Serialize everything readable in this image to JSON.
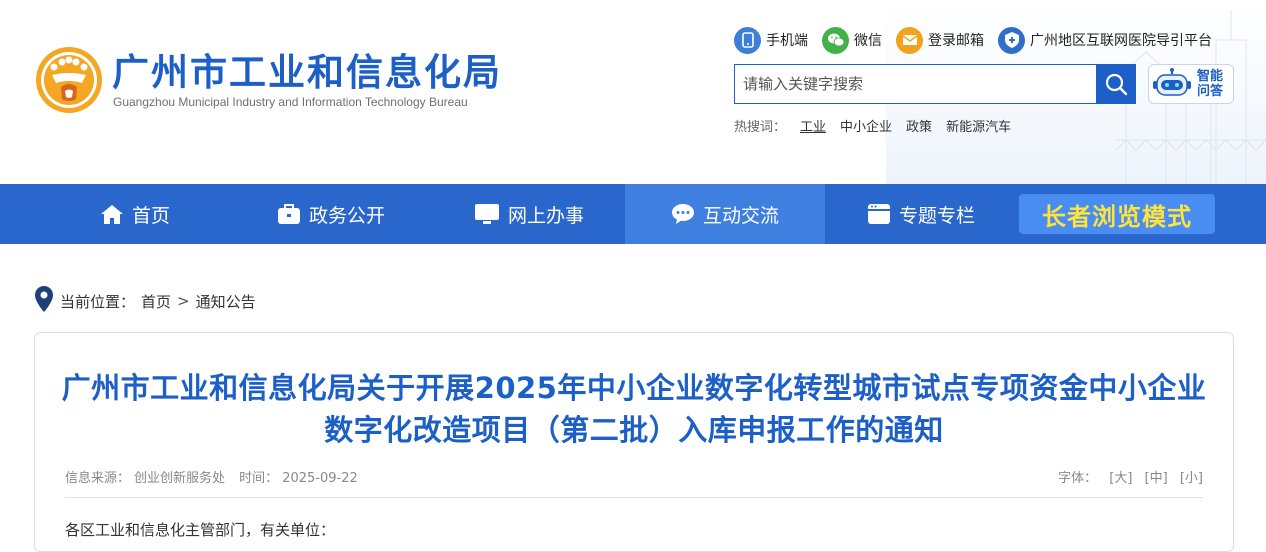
{
  "site": {
    "title": "广州市工业和信息化局",
    "subtitle": "Guangzhou Municipal Industry and Information Technology Bureau"
  },
  "top_links": [
    {
      "label": "手机端",
      "icon": "mobile-icon",
      "color": "#3d7fd6"
    },
    {
      "label": "微信",
      "icon": "wechat-icon",
      "color": "#43b14b"
    },
    {
      "label": "登录邮箱",
      "icon": "mail-icon",
      "color": "#f2a21f"
    },
    {
      "label": "广州地区互联网医院导引平台",
      "icon": "hospital-shield-icon",
      "color": "#2f6fc9"
    }
  ],
  "search": {
    "placeholder": "请输入关键字搜索",
    "hot_label": "热搜词：",
    "hot_words": [
      "工业",
      "中小企业",
      "政策",
      "新能源汽车"
    ]
  },
  "ai_assistant": {
    "line1": "智能",
    "line2": "问答",
    "icon": "robot-icon"
  },
  "nav": {
    "items": [
      {
        "label": "首页",
        "icon": "home-icon"
      },
      {
        "label": "政务公开",
        "icon": "briefcase-icon"
      },
      {
        "label": "网上办事",
        "icon": "monitor-icon"
      },
      {
        "label": "互动交流",
        "icon": "chat-icon",
        "active": true
      },
      {
        "label": "专题专栏",
        "icon": "window-icon"
      }
    ],
    "elder_mode": "长者浏览模式"
  },
  "breadcrumb": {
    "label": "当前位置：",
    "items": [
      "首页",
      "通知公告"
    ],
    "separator": ">"
  },
  "article": {
    "title": "广州市工业和信息化局关于开展2025年中小企业数字化转型城市试点专项资金中小企业数字化改造项目（第二批）入库申报工作的通知",
    "source_label": "信息来源：",
    "source": "创业创新服务处",
    "time_label": "时间：",
    "time": "2025-09-22",
    "font_label": "字体：",
    "font_sizes": [
      "[大]",
      "[中]",
      "[小]"
    ],
    "body_first_line": "各区工业和信息化主管部门，有关单位："
  },
  "colors": {
    "brand": "#1b5fc7",
    "nav_bg": "#2a67cc",
    "nav_active": "#3f7fe0",
    "elder_bg": "#4a8df2",
    "elder_text": "#ffe33b"
  }
}
